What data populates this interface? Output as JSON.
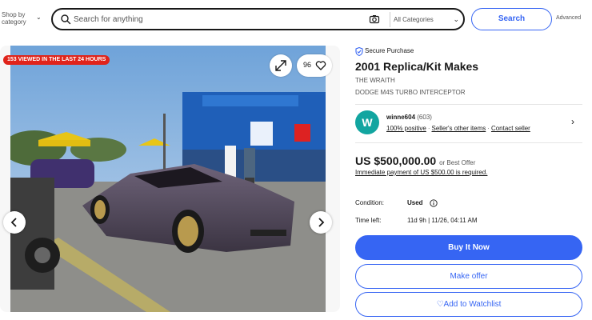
{
  "header": {
    "shop_by_category": "Shop by category",
    "search_placeholder": "Search for anything",
    "category_select": "All Categories",
    "search_button": "Search",
    "advanced": "Advanced"
  },
  "gallery": {
    "views_badge": "153 VIEWED IN THE LAST 24 HOURS",
    "watch_count": "96",
    "icons": [
      "expand-icon",
      "heart-icon",
      "chevron-left-icon",
      "chevron-right-icon"
    ]
  },
  "listing": {
    "secure_purchase": "Secure Purchase",
    "title": "2001 Replica/Kit Makes",
    "subtitle_make": "THE WRAITH",
    "subtitle_model": "DODGE M4S TURBO INTERCEPTOR",
    "seller": {
      "avatar_letter": "W",
      "name": "winne604",
      "feedback_count": "(603)",
      "positive": "100% positive",
      "other_items": "Seller's other items",
      "contact": "Contact seller"
    },
    "price": "US $500,000.00",
    "best_offer": "or Best Offer",
    "payment_note": "Immediate payment of US $500.00 is required.",
    "condition_label": "Condition:",
    "condition_value": "Used",
    "time_left_label": "Time left:",
    "time_left_value": "11d 9h | 11/26, 04:11 AM",
    "buy_now": "Buy It Now",
    "make_offer": "Make offer",
    "add_to_watchlist": "Add to Watchlist"
  },
  "colors": {
    "accent_blue": "#3665f3",
    "badge_red": "#e0241b",
    "avatar_teal": "#12a5a0",
    "text_dark": "#191919",
    "text_muted": "#555555"
  }
}
